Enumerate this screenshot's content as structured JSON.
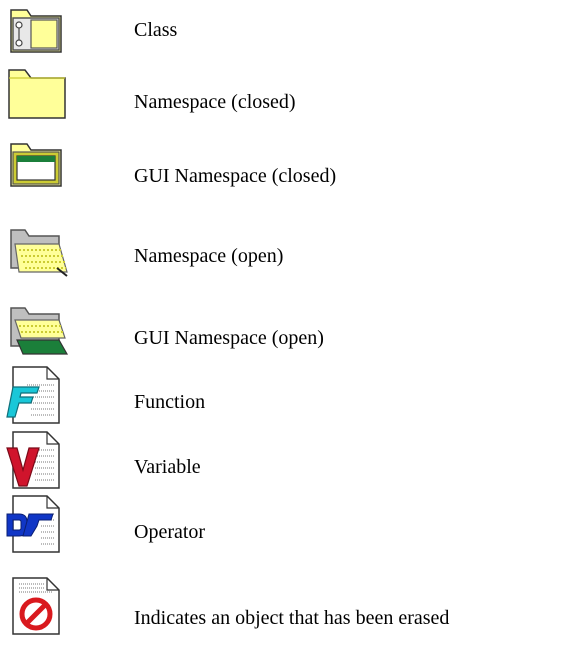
{
  "legend": {
    "items": [
      {
        "icon": "class-icon",
        "label": "Class"
      },
      {
        "icon": "namespace-closed-icon",
        "label": "Namespace (closed)"
      },
      {
        "icon": "gui-namespace-closed-icon",
        "label": "GUI Namespace (closed)"
      },
      {
        "icon": "namespace-open-icon",
        "label": "Namespace (open)"
      },
      {
        "icon": "gui-namespace-open-icon",
        "label": "GUI Namespace (open)"
      },
      {
        "icon": "function-icon",
        "label": "Function"
      },
      {
        "icon": "variable-icon",
        "label": "Variable"
      },
      {
        "icon": "operator-icon",
        "label": "Operator"
      },
      {
        "icon": "erased-object-icon",
        "label": "Indicates an object that has been erased"
      }
    ]
  },
  "colors": {
    "folder_yellow": "#ffff99",
    "folder_dark_yellow": "#cccc33",
    "open_folder_gray": "#bfbfbf",
    "function_cyan": "#19c7d8",
    "variable_red": "#d0142c",
    "operator_blue": "#1036c6",
    "erased_red": "#d9191e"
  }
}
